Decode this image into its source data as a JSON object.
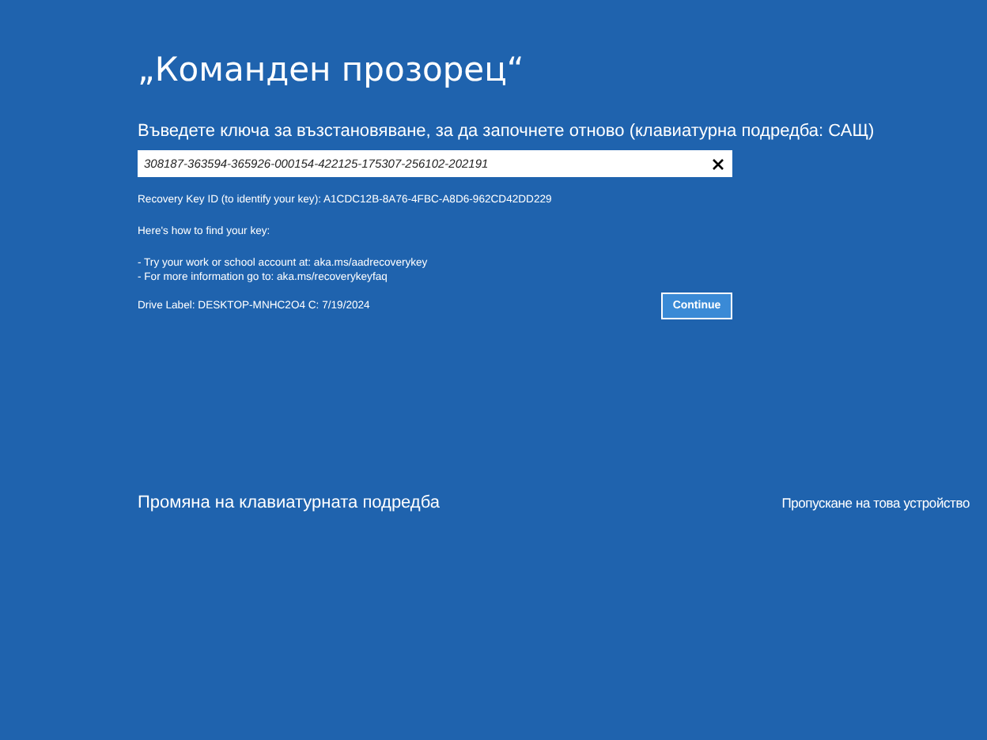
{
  "title": "„Команден прозорец“",
  "prompt": "Въведете ключа за възстановяване, за да започнете отново (клавиатурна подредба: САЩ)",
  "key_field": {
    "value": "308187-363594-365926-000154-422125-175307-256102-202191"
  },
  "info_paragraphs": [
    [
      "Recovery Key ID (to identify your key): A1CDC12B-8A76-4FBC-A8D6-962CD42DD229"
    ],
    [
      "Here's how to find your key:"
    ],
    [
      "- Try your work or school account at: aka.ms/aadrecoverykey",
      "- For more information go to: aka.ms/recoverykeyfaq"
    ]
  ],
  "drive_label": "Drive Label: DESKTOP-MNHC2O4 C: 7/19/2024",
  "continue_button": "Continue",
  "change_layout_link": "Промяна на клавиатурната подредба",
  "skip_link": "Пропускане на това устройство"
}
